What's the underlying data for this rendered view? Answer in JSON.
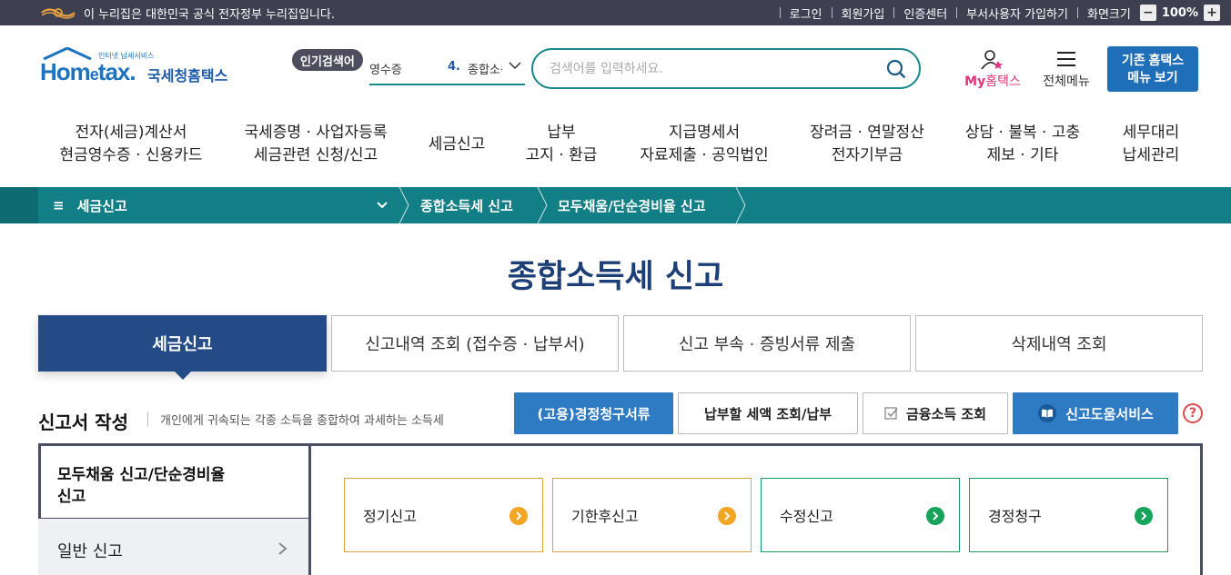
{
  "gov_banner": {
    "notice": "이 누리집은 대한민국 공식 전자정부 누리집입니다.",
    "links": [
      "로그인",
      "회원가입",
      "인증센터",
      "부서사용자 가입하기",
      "화면크기"
    ],
    "zoom": "100%",
    "zoom_minus": "−",
    "zoom_plus": "+"
  },
  "header": {
    "logo_home": "Hom",
    "logo_e": "e",
    "logo_tax": "tax.",
    "logo_small": "인터넷 납세서비스",
    "logo_korean": "국세청홈택스",
    "popular_label": "인기검색어",
    "popular_prev": "영수증",
    "popular_rank": "4.",
    "popular_current": "종합소득세",
    "search_placeholder": "검색어를 입력하세요.",
    "my_hometax_my": "My",
    "my_hometax_rest": "홈택스",
    "all_menu": "전체메뉴",
    "old_hometax_line1": "기존 홈택스",
    "old_hometax_line2": "메뉴 보기"
  },
  "gnb": [
    {
      "line1": "전자(세금)계산서",
      "line2": "현금영수증 · 신용카드"
    },
    {
      "line1": "국세증명 · 사업자등록",
      "line2": "세금관련 신청/신고"
    },
    {
      "line1": "세금신고",
      "line2": ""
    },
    {
      "line1": "납부",
      "line2": "고지 · 환급"
    },
    {
      "line1": "지급명세서",
      "line2": "자료제출 · 공익법인"
    },
    {
      "line1": "장려금 · 연말정산",
      "line2": "전자기부금"
    },
    {
      "line1": "상담 · 불복 · 고충",
      "line2": "제보 · 기타"
    },
    {
      "line1": "세무대리",
      "line2": "납세관리"
    }
  ],
  "breadcrumb": {
    "root": "세금신고",
    "items": [
      "종합소득세 신고",
      "모두채움/단순경비율 신고"
    ]
  },
  "page_title": "종합소득세 신고",
  "tabs": [
    "세금신고",
    "신고내역 조회 (접수증 · 납부서)",
    "신고 부속 · 증빙서류 제출",
    "삭제내역 조회"
  ],
  "section": {
    "title": "신고서 작성",
    "desc": "개인에게 귀속되는 각종 소득을 종합하여 과세하는 소득세",
    "buttons": [
      "(고용)경정청구서류",
      "납부할 세액 조회/납부",
      "금융소득 조회",
      "신고도움서비스"
    ],
    "help": "?"
  },
  "side_menu": {
    "active_line1": "모두채움 신고/단순경비율",
    "active_line2": "신고",
    "general": "일반 신고"
  },
  "filing_cards": [
    "정기신고",
    "기한후신고",
    "수정신고",
    "경정청구"
  ],
  "colors": {
    "teal": "#127f86",
    "navy": "#244b86",
    "blue": "#2e7bc4",
    "orange": "#f2a623",
    "green": "#16a35a"
  }
}
